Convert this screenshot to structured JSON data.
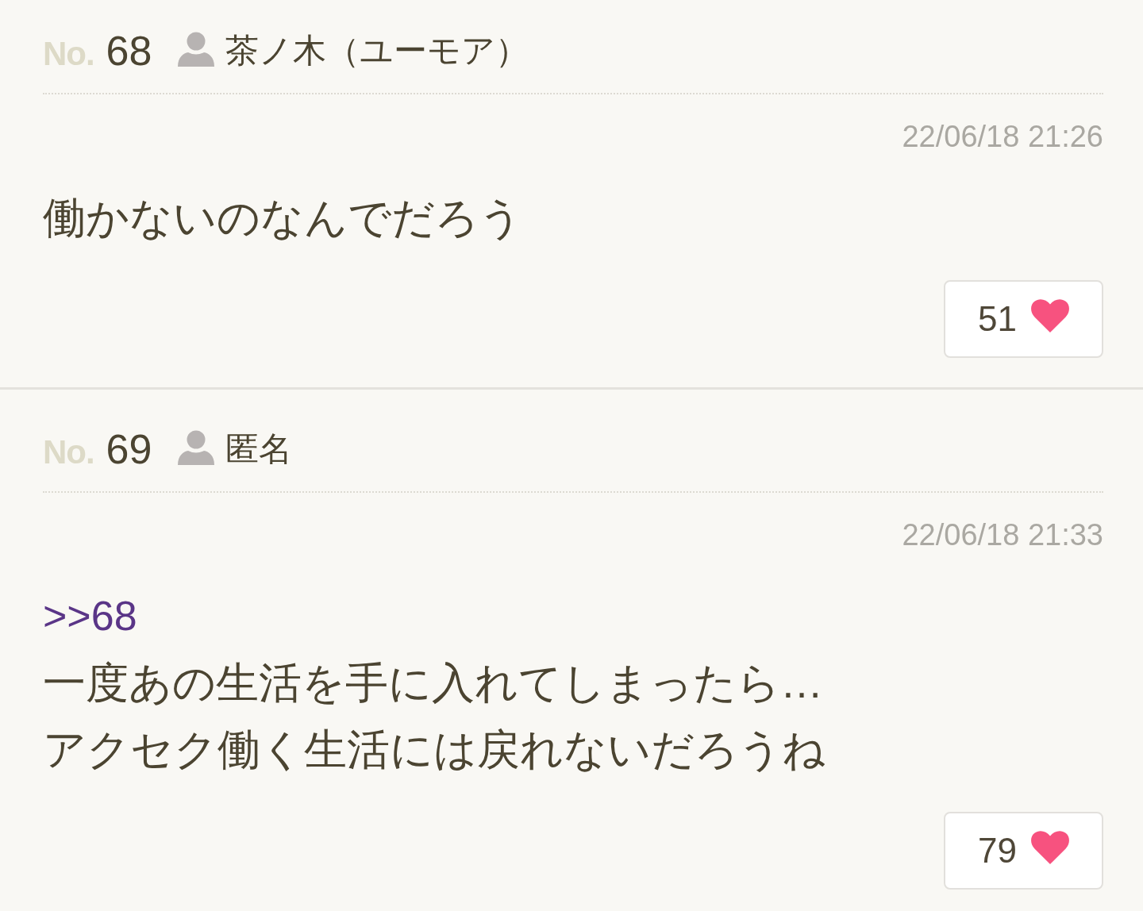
{
  "posts": [
    {
      "number_label": "No.",
      "number": "68",
      "author": "茶ノ木（ユーモア）",
      "date": "22/06/18 21:26",
      "body": [
        {
          "kind": "text",
          "text": "働かないのなんでだろう"
        }
      ],
      "likes": "51"
    },
    {
      "number_label": "No.",
      "number": "69",
      "author": "匿名",
      "date": "22/06/18 21:33",
      "body": [
        {
          "kind": "reply",
          "text": ">>68"
        },
        {
          "kind": "text",
          "text": "一度あの生活を手に入れてしまったら…"
        },
        {
          "kind": "text",
          "text": "アクセク働く生活には戻れないだろうね"
        }
      ],
      "likes": "79"
    }
  ]
}
